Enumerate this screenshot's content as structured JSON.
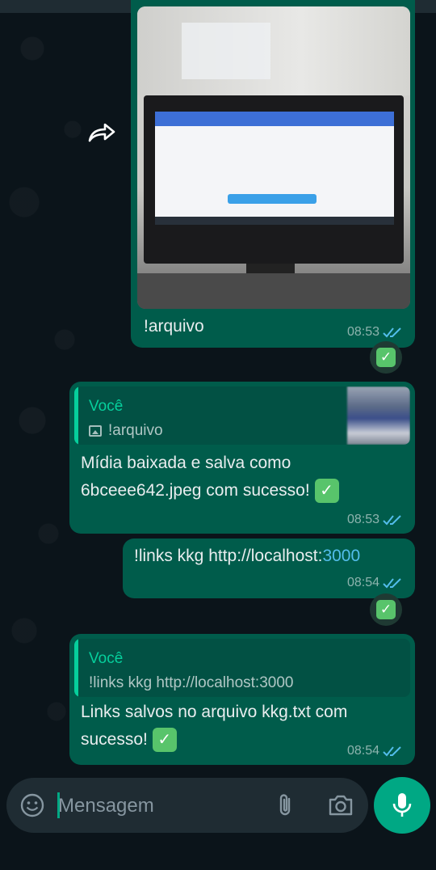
{
  "messages": [
    {
      "type": "image",
      "caption": "!arquivo",
      "time": "08:53",
      "status": "read"
    },
    {
      "type": "reply",
      "quote_author": "Você",
      "quote_text": "!arquivo",
      "body": "Mídia baixada e salva como 6bceee642.jpeg com sucesso!",
      "time": "08:53",
      "status": "read"
    },
    {
      "type": "text",
      "body_prefix": "!links kkg http://localhost:",
      "body_port": "3000",
      "time": "08:54",
      "status": "read"
    },
    {
      "type": "reply",
      "quote_author": "Você",
      "quote_text": "!links kkg http://localhost:3000",
      "body": "Links salvos no arquivo kkg.txt com sucesso!",
      "time": "08:54",
      "status": "read"
    }
  ],
  "composer": {
    "placeholder": "Mensagem"
  },
  "colors": {
    "background": "#0b141a",
    "outgoing_bubble": "#005c4b",
    "accent": "#00a884",
    "quote_author": "#06cf9c",
    "read_ticks": "#53bdeb"
  },
  "icons": [
    "forward-icon",
    "image-icon",
    "double-check-icon",
    "check-emoji-icon",
    "emoji-icon",
    "attach-icon",
    "camera-icon",
    "mic-icon"
  ]
}
